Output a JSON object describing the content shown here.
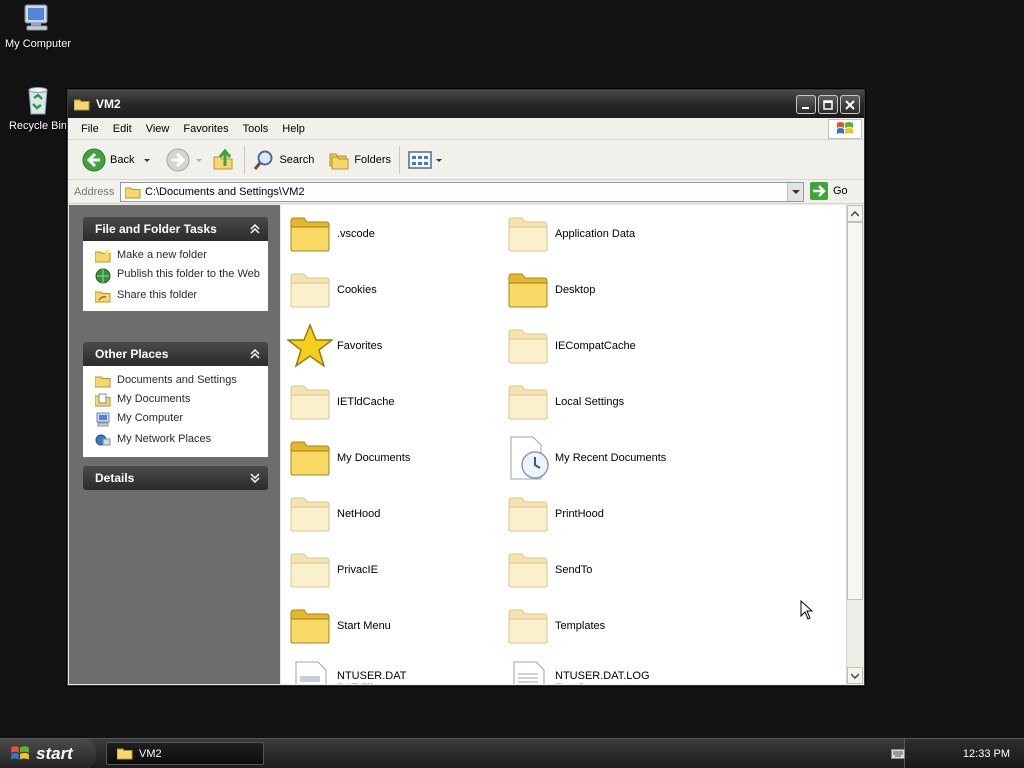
{
  "desktop": {
    "icons": [
      {
        "label": "My Computer",
        "icon": "my-computer-icon"
      },
      {
        "label": "Recycle Bin",
        "icon": "recycle-bin-icon"
      }
    ]
  },
  "window": {
    "title": "VM2",
    "menu": [
      "File",
      "Edit",
      "View",
      "Favorites",
      "Tools",
      "Help"
    ],
    "toolbar": {
      "back": "Back",
      "search": "Search",
      "folders": "Folders"
    },
    "address": {
      "label": "Address",
      "value": "C:\\Documents and Settings\\VM2",
      "go": "Go"
    }
  },
  "tasks": {
    "title": "File and Folder Tasks",
    "items": [
      "Make a new folder",
      "Publish this folder to the Web",
      "Share this folder"
    ]
  },
  "other_places": {
    "title": "Other Places",
    "items": [
      "Documents and Settings",
      "My Documents",
      "My Computer",
      "My Network Places"
    ]
  },
  "details": {
    "title": "Details"
  },
  "files": [
    {
      "name": ".vscode",
      "type": "folder"
    },
    {
      "name": "Application Data",
      "type": "folder-ghost"
    },
    {
      "name": "Cookies",
      "type": "folder-ghost"
    },
    {
      "name": "Desktop",
      "type": "folder"
    },
    {
      "name": "Favorites",
      "type": "star"
    },
    {
      "name": "IECompatCache",
      "type": "folder-ghost"
    },
    {
      "name": "IETldCache",
      "type": "folder-ghost"
    },
    {
      "name": "Local Settings",
      "type": "folder-ghost"
    },
    {
      "name": "My Documents",
      "type": "folder"
    },
    {
      "name": "My Recent Documents",
      "type": "recent"
    },
    {
      "name": "NetHood",
      "type": "folder-ghost"
    },
    {
      "name": "PrintHood",
      "type": "folder-ghost"
    },
    {
      "name": "PrivacIE",
      "type": "folder-ghost"
    },
    {
      "name": "SendTo",
      "type": "folder-ghost"
    },
    {
      "name": "Start Menu",
      "type": "folder"
    },
    {
      "name": "Templates",
      "type": "folder-ghost"
    },
    {
      "name": "NTUSER.DAT",
      "type": "dat",
      "sub": "DAT File"
    },
    {
      "name": "NTUSER.DAT.LOG",
      "type": "txt",
      "sub": "Text Document"
    }
  ],
  "taskbar": {
    "start": "start",
    "task": "VM2",
    "clock": "12:33 PM"
  }
}
